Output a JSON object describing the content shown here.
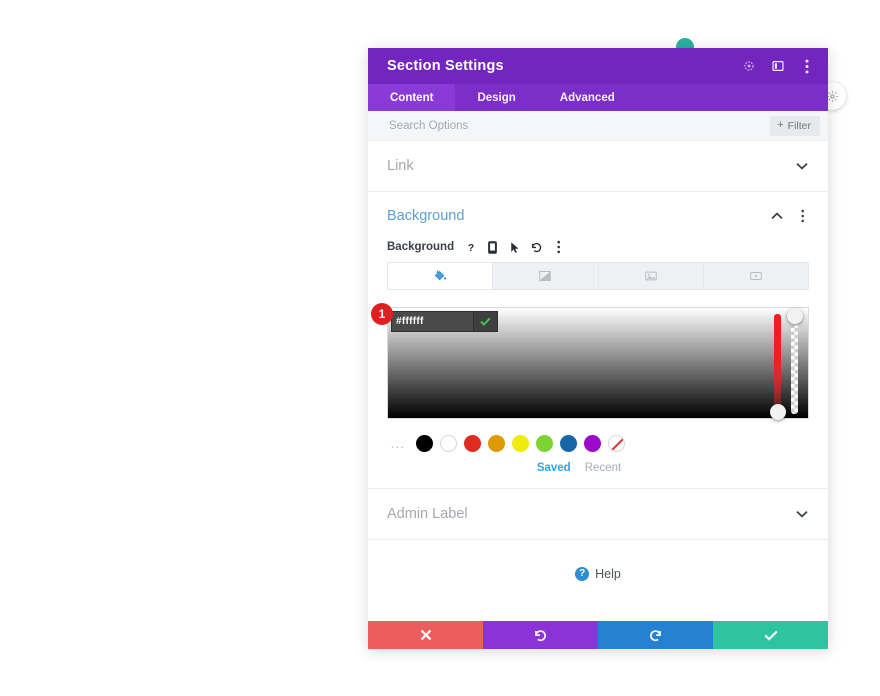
{
  "window": {
    "title": "Section Settings"
  },
  "header": {
    "icons": [
      {
        "name": "focus-target-icon",
        "label": "Focus"
      },
      {
        "name": "layout-panel-icon",
        "label": "Layout"
      },
      {
        "name": "kebab-menu-icon",
        "label": "More Options"
      }
    ]
  },
  "tabs": [
    {
      "label": "Content",
      "active": true
    },
    {
      "label": "Design",
      "active": false
    },
    {
      "label": "Advanced",
      "active": false
    }
  ],
  "search": {
    "placeholder": "Search Options",
    "value": "",
    "filter_label": "Filter",
    "filter_plus": "+"
  },
  "sections": {
    "link": {
      "title": "Link",
      "expanded": false
    },
    "background": {
      "title": "Background",
      "expanded": true,
      "field_label": "Background",
      "tool_icons": [
        {
          "name": "help-icon",
          "glyph": "?"
        },
        {
          "name": "responsive-mobile-icon"
        },
        {
          "name": "hover-cursor-icon"
        },
        {
          "name": "reset-undo-icon"
        },
        {
          "name": "kebab-menu-icon"
        }
      ],
      "type_tabs": [
        {
          "name": "background-color-tab",
          "active": true
        },
        {
          "name": "background-gradient-tab",
          "active": false
        },
        {
          "name": "background-image-tab",
          "active": false
        },
        {
          "name": "background-video-tab",
          "active": false
        }
      ],
      "color_picker": {
        "hex_value": "#ffffff",
        "confirm_label": "Apply color",
        "step_badge": "1",
        "hue_handle_position": "bottom",
        "alpha_handle_position": "top"
      },
      "swatches": {
        "more_label": "...",
        "colors": [
          {
            "name": "swatch-black",
            "hex": "#000000"
          },
          {
            "name": "swatch-white",
            "hex": "#ffffff"
          },
          {
            "name": "swatch-red",
            "hex": "#e02b20"
          },
          {
            "name": "swatch-orange",
            "hex": "#e09900"
          },
          {
            "name": "swatch-yellow",
            "hex": "#edec0c"
          },
          {
            "name": "swatch-green",
            "hex": "#7cd433"
          },
          {
            "name": "swatch-blue",
            "hex": "#1767a8"
          },
          {
            "name": "swatch-purple",
            "hex": "#9b09c9"
          },
          {
            "name": "swatch-none",
            "hex": "transparent"
          }
        ],
        "tabs": [
          {
            "label": "Saved",
            "active": true
          },
          {
            "label": "Recent",
            "active": false
          }
        ]
      }
    },
    "admin_label": {
      "title": "Admin Label",
      "expanded": false
    }
  },
  "help": {
    "label": "Help",
    "icon_glyph": "?"
  },
  "footer": {
    "buttons": [
      {
        "name": "cancel-button",
        "color": "#ec5e5e",
        "icon": "close-icon"
      },
      {
        "name": "undo-button",
        "color": "#8b33d6",
        "icon": "undo-icon"
      },
      {
        "name": "redo-button",
        "color": "#2681d3",
        "icon": "redo-icon"
      },
      {
        "name": "save-button",
        "color": "#2ec4a0",
        "icon": "check-icon"
      }
    ]
  },
  "colors": {
    "header_purple": "#7326bf",
    "tabs_purple": "#7c2ec9",
    "active_tab_purple": "#8a3ad6",
    "section_title_blue": "#5a9fd4",
    "accent_blue": "#2ea3f2",
    "badge_red": "#e02020"
  }
}
